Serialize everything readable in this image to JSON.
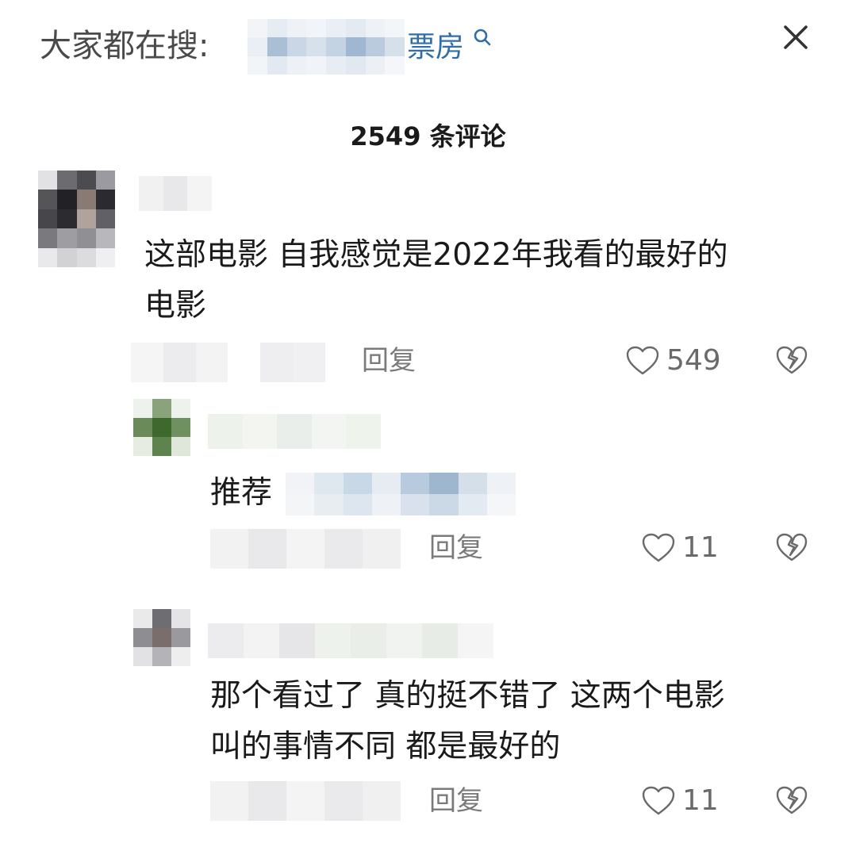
{
  "search": {
    "prefix": "大家都在搜:",
    "suffix": "票房"
  },
  "comment_count": "2549 条评论",
  "comments": [
    {
      "text_lines": [
        "这部电影  自我感觉是2022年我看的最好的",
        "电影"
      ],
      "reply_label": "回复",
      "likes": "549"
    },
    {
      "text_lines": [
        "推荐"
      ],
      "reply_label": "回复",
      "likes": "11"
    },
    {
      "text_lines": [
        "那个看过了  真的挺不错了 这两个电影",
        "叫的事情不同  都是最好的"
      ],
      "reply_label": "回复",
      "likes": "11"
    }
  ],
  "colors": {
    "link_blue": "#2f6ea8",
    "muted_gray": "#7a7a7a"
  },
  "icons": [
    "search-icon",
    "close-icon",
    "heart-icon",
    "broken-heart-icon"
  ]
}
